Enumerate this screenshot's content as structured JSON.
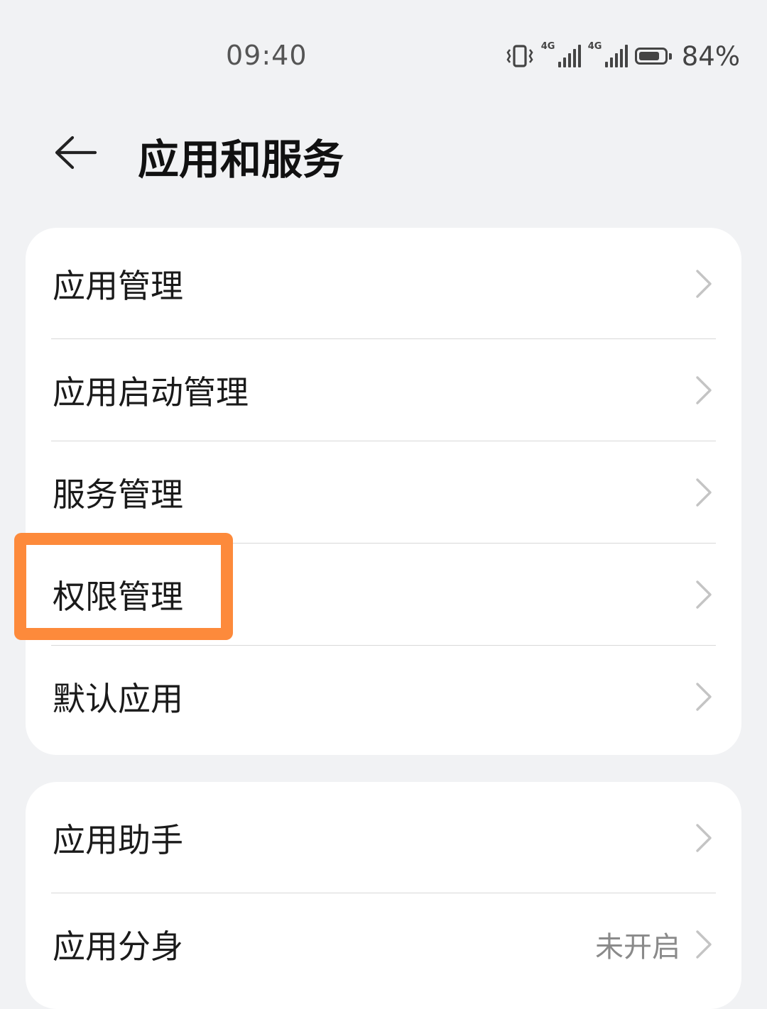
{
  "status_bar": {
    "time": "09:40",
    "signal1_tag": "4G",
    "signal2_tag": "4G",
    "battery_percent": "84%",
    "battery_level": 0.84
  },
  "header": {
    "title": "应用和服务"
  },
  "group1": [
    {
      "label": "应用管理"
    },
    {
      "label": "应用启动管理"
    },
    {
      "label": "服务管理"
    },
    {
      "label": "权限管理"
    },
    {
      "label": "默认应用"
    }
  ],
  "group2": [
    {
      "label": "应用助手",
      "value": ""
    },
    {
      "label": "应用分身",
      "value": "未开启"
    }
  ],
  "colors": {
    "highlight": "#fd8a3b",
    "background": "#f1f2f4"
  }
}
